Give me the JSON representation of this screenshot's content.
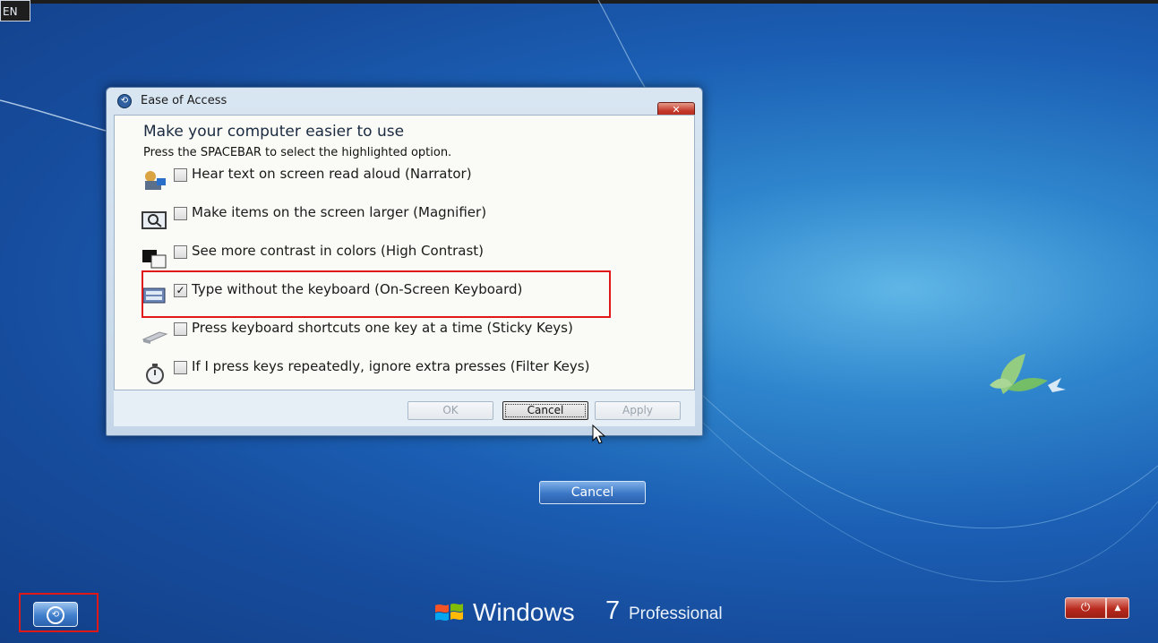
{
  "language_indicator": "EN",
  "dialog": {
    "title": "Ease of Access",
    "close_symbol": "✕",
    "heading": "Make your computer easier to use",
    "instruction": "Press the SPACEBAR to select the highlighted option.",
    "options": [
      {
        "label": "Hear text on screen read aloud (Narrator)",
        "checked": false,
        "icon": "narrator-icon"
      },
      {
        "label": "Make items on the screen larger (Magnifier)",
        "checked": false,
        "icon": "magnifier-icon"
      },
      {
        "label": "See more contrast in colors (High Contrast)",
        "checked": false,
        "icon": "high-contrast-icon"
      },
      {
        "label": "Type without the keyboard (On-Screen Keyboard)",
        "checked": true,
        "icon": "on-screen-keyboard-icon"
      },
      {
        "label": "Press keyboard shortcuts one key at a time (Sticky Keys)",
        "checked": false,
        "icon": "sticky-keys-icon"
      },
      {
        "label": "If I press keys repeatedly, ignore extra presses (Filter Keys)",
        "checked": false,
        "icon": "filter-keys-icon"
      }
    ],
    "buttons": {
      "ok": "OK",
      "cancel": "Cancel",
      "apply": "Apply"
    }
  },
  "logon": {
    "cancel_label": "Cancel",
    "brand_windows": "Windows",
    "brand_version": "7",
    "brand_edition": "Professional",
    "power_symbol": "⏻",
    "power_arrow": "▲"
  },
  "colors": {
    "accent_red": "#e01818",
    "desktop_blue": "#1b5fb4",
    "power_red": "#b8291c"
  }
}
